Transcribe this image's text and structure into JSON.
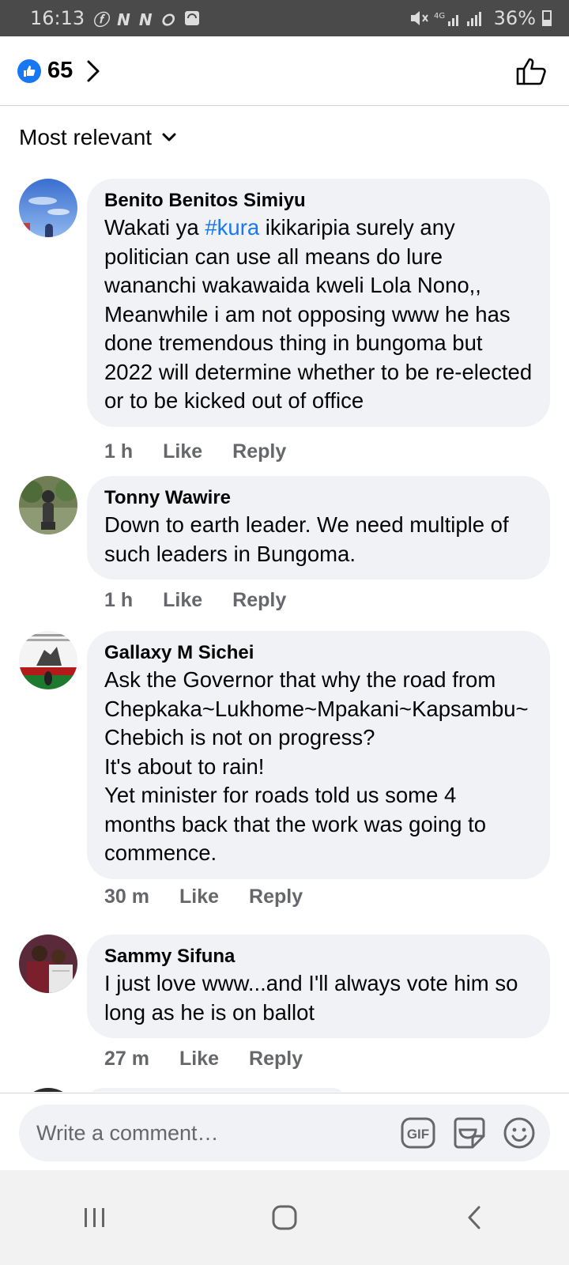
{
  "status_bar": {
    "time": "16:13",
    "notification_icons": "ⓕ N N ⭘",
    "battery": "36%"
  },
  "header": {
    "reaction_count": "65"
  },
  "sort": {
    "label": "Most relevant"
  },
  "comments": [
    {
      "author": "Benito Benitos Simiyu",
      "text_before": "Wakati ya ",
      "hashtag": "#kura",
      "text_after": " ikikaripia surely any politician can use all means do lure wananchi wakawaida kweli Lola Nono,, Meanwhile i am not opposing www he has done tremendous thing in bungoma but 2022 will determine whether to be re-elected or to be kicked out of office",
      "time": "1 h",
      "like": "Like",
      "reply": "Reply"
    },
    {
      "author": "Tonny Wawire",
      "text": "Down to earth leader. We need multiple of such leaders in Bungoma.",
      "time": "1 h",
      "like": "Like",
      "reply": "Reply"
    },
    {
      "author": "Gallaxy M Sichei",
      "text": "Ask the Governor that why the road from Chepkaka~Lukhome~Mpakani~Kapsambu~ Chebich is not on progress?\nIt's about to rain!\nYet minister for roads told us some 4 months back that the work was going to commence.",
      "time": "30 m",
      "like": "Like",
      "reply": "Reply"
    },
    {
      "author": "Sammy Sifuna",
      "text": "I just love www...and I'll always vote him so long as he is on ballot",
      "time": "27 m",
      "like": "Like",
      "reply": "Reply"
    }
  ],
  "composer": {
    "placeholder": "Write a comment…",
    "gif_label": "GIF"
  },
  "colors": {
    "accent": "#1877f2",
    "bubble": "#f0f2f5",
    "meta": "#65676b"
  }
}
